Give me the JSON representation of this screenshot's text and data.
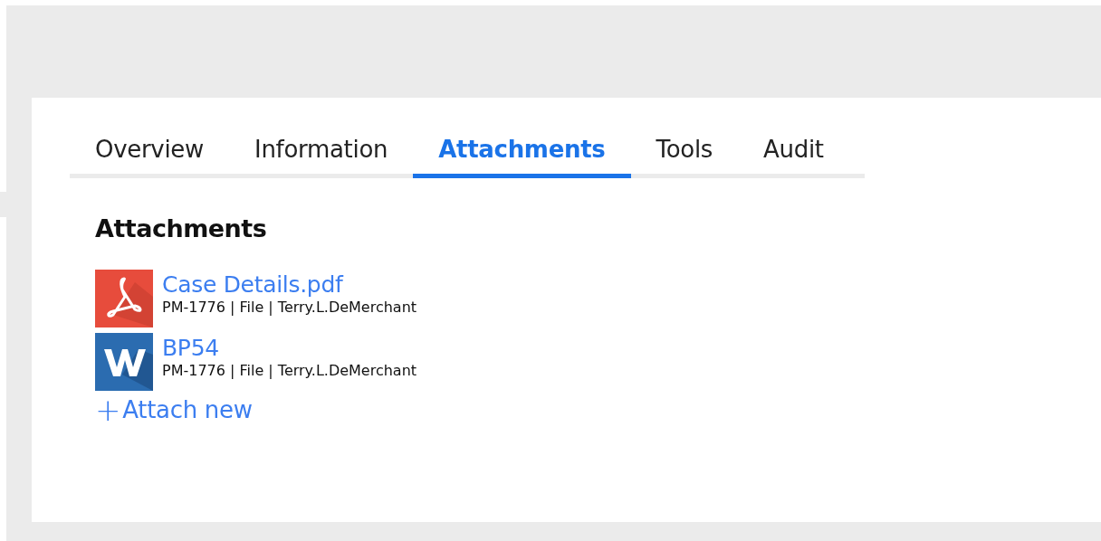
{
  "tabs": [
    {
      "label": "Overview",
      "selected": false
    },
    {
      "label": "Information",
      "selected": false
    },
    {
      "label": "Attachments",
      "selected": true
    },
    {
      "label": "Tools",
      "selected": false
    },
    {
      "label": "Audit",
      "selected": false
    }
  ],
  "section_title": "Attachments",
  "attachments": [
    {
      "kind": "pdf",
      "name": "Case Details.pdf",
      "meta": "PM-1776 | File | Terry.L.DeMerchant"
    },
    {
      "kind": "word",
      "name": "BP54",
      "meta": "PM-1776 | File | Terry.L.DeMerchant"
    }
  ],
  "attach_new": {
    "icon": "+",
    "label": "Attach new"
  }
}
